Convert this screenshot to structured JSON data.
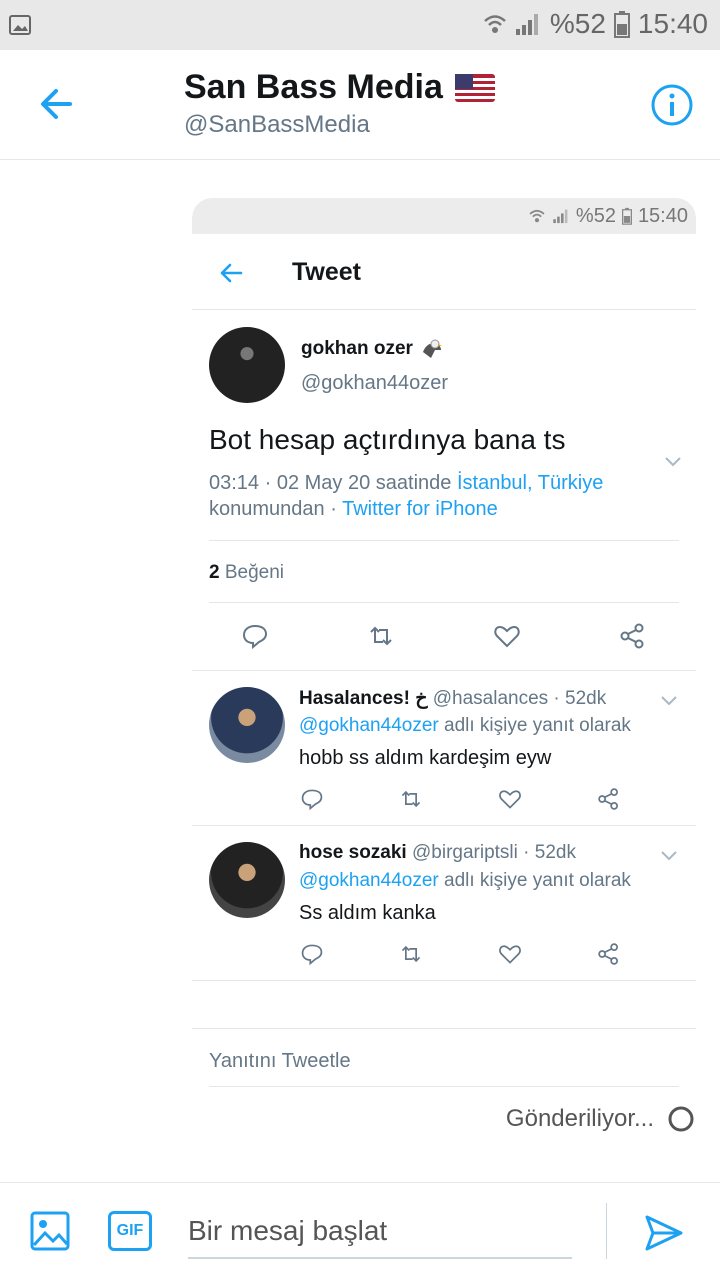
{
  "status_bar": {
    "battery": "%52",
    "time": "15:40"
  },
  "header": {
    "title": "San Bass Media",
    "handle": "@SanBassMedia"
  },
  "screenshot": {
    "status_bar": {
      "battery": "%52",
      "time": "15:40"
    },
    "header_title": "Tweet",
    "tweet": {
      "name": "gokhan ozer",
      "handle": "@gokhan44ozer",
      "text": "Bot hesap açtırdınya bana ts",
      "meta_time": "03:14 · 02 May 20 saatinde",
      "meta_location": "İstanbul, Türkiye",
      "meta_suffix": "konumundan ·",
      "meta_source": "Twitter for iPhone",
      "likes_count": "2",
      "likes_label": "Beğeni"
    },
    "replies": [
      {
        "name": "Hasalances! خ",
        "handle": "@hasalances · 52dk",
        "reply_to": "@gokhan44ozer",
        "reply_to_suffix": "adlı kişiye yanıt olarak",
        "text": "hobb ss aldım kardeşim eyw"
      },
      {
        "name": "hose sozaki",
        "handle": "@birgariptsli · 52dk",
        "reply_to": "@gokhan44ozer",
        "reply_to_suffix": "adlı kişiye yanıt olarak",
        "text": "Ss aldım kanka"
      }
    ],
    "reply_prompt": "Yanıtını Tweetle"
  },
  "sending_label": "Gönderiliyor...",
  "composer": {
    "gif_label": "GIF",
    "placeholder": "Bir mesaj başlat"
  },
  "colors": {
    "accent": "#1da1f2",
    "muted": "#657786",
    "divider": "#e1e8ed"
  }
}
